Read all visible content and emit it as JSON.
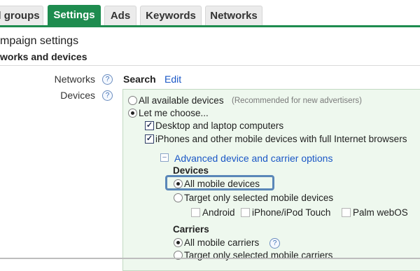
{
  "tabs": [
    {
      "label": "l groups",
      "active": false
    },
    {
      "label": "Settings",
      "active": true
    },
    {
      "label": "Ads",
      "active": false
    },
    {
      "label": "Keywords",
      "active": false
    },
    {
      "label": "Networks",
      "active": false
    }
  ],
  "page": {
    "title": "mpaign settings",
    "section": "works and devices"
  },
  "networks": {
    "label": "Networks",
    "value": "Search",
    "edit": "Edit"
  },
  "devices": {
    "label": "Devices",
    "all_available": "All available devices",
    "all_available_note": "(Recommended for new advertisers)",
    "let_me_choose": "Let me choose...",
    "desktop": "Desktop and laptop computers",
    "iphones": "iPhones and other mobile devices with full Internet browsers",
    "advanced_link": "Advanced device and carrier options",
    "devices_header": "Devices",
    "all_mobile_devices": "All mobile devices",
    "target_selected_devices": "Target only selected mobile devices",
    "android": "Android",
    "iphone_touch": "iPhone/iPod Touch",
    "palm": "Palm webOS",
    "carriers_header": "Carriers",
    "all_mobile_carriers": "All mobile carriers",
    "target_selected_carriers": "Target only selected mobile carriers"
  },
  "colors": {
    "accent": "#1e8c4f",
    "link": "#1a57c6",
    "panel_bg": "#eef8ee",
    "highlight": "#5a87b8"
  },
  "icons": {
    "help": "question-mark-circle-icon",
    "collapse": "minus-box-icon"
  }
}
